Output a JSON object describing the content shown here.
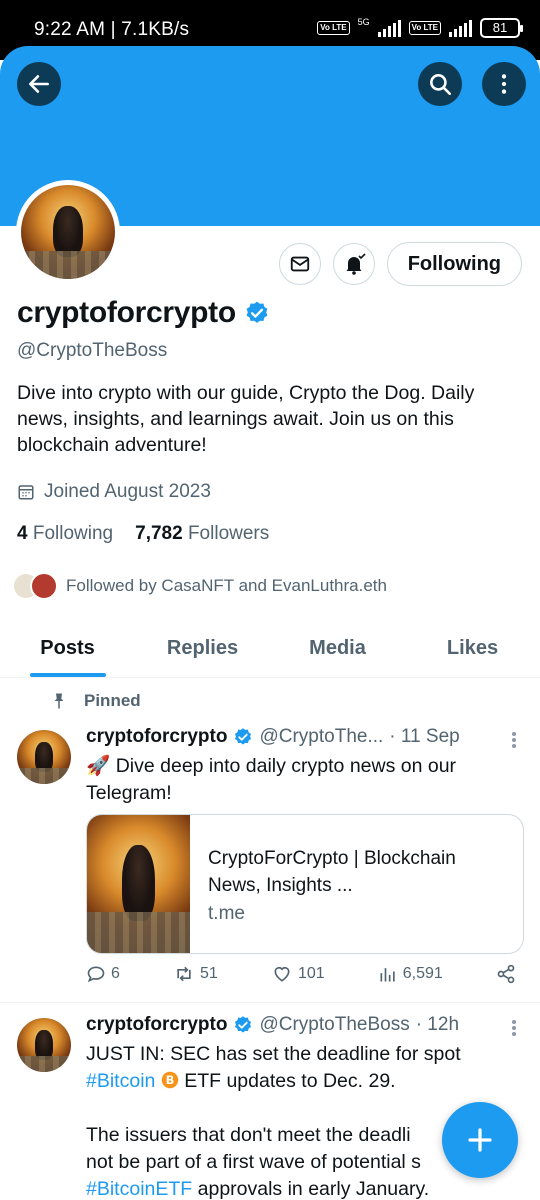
{
  "status_bar": {
    "time": "9:22 AM | 7.1KB/s",
    "network_5g": "5G",
    "volte1": "Vo LTE",
    "volte2": "Vo LTE",
    "battery": "81"
  },
  "header": {
    "icons": [
      "back-arrow-icon",
      "search-icon",
      "more-vertical-icon"
    ],
    "banner_color": "#1d9bf0"
  },
  "profile": {
    "display_name": "cryptoforcrypto",
    "handle": "@CryptoTheBoss",
    "bio": "Dive into crypto with our guide, Crypto the Dog. Daily news, insights, and learnings await.   Join us on this blockchain adventure!",
    "joined": "Joined August 2023",
    "following_count": "4",
    "following_label": "Following",
    "followers_count": "7,782",
    "followers_label": "Followers",
    "followed_by": "Followed by CasaNFT and EvanLuthra.eth",
    "follow_button": "Following"
  },
  "tabs": [
    {
      "label": "Posts",
      "active": true
    },
    {
      "label": "Replies",
      "active": false
    },
    {
      "label": "Media",
      "active": false
    },
    {
      "label": "Likes",
      "active": false
    }
  ],
  "pinned_label": "Pinned",
  "tweets": [
    {
      "user": "cryptoforcrypto",
      "handle": "@CryptoThe...",
      "time": "· 11 Sep",
      "text": "🚀 Dive deep into daily crypto news on our Telegram!",
      "card": {
        "title": "CryptoForCrypto | Blockchain News, Insights ...",
        "domain": "t.me"
      },
      "replies": "6",
      "retweets": "51",
      "likes": "101",
      "views": "6,591"
    },
    {
      "user": "cryptoforcrypto",
      "handle": "@CryptoTheBoss",
      "time": "· 12h",
      "line1": "JUST IN: SEC has set the deadline for spot",
      "hashtag1": "#Bitcoin",
      "line2": "ETF updates to Dec. 29.",
      "line3": "The issuers that don't meet the deadli",
      "line4": "not be part of a first wave of potential s",
      "hashtag2": "#BitcoinETF",
      "line5": "approvals in early January."
    }
  ],
  "accent_color": "#1d9bf0",
  "verified_color": "#1d9bf0"
}
